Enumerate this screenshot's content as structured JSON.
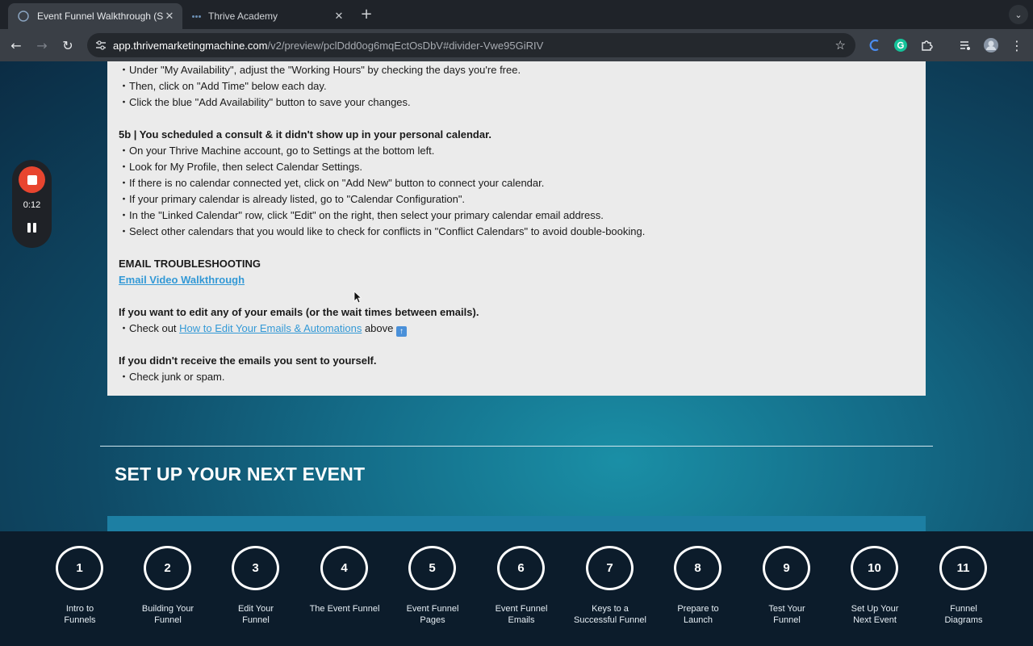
{
  "browser": {
    "tabs": [
      {
        "title": "Event Funnel Walkthrough (S",
        "active": true
      },
      {
        "title": "Thrive Academy",
        "active": false
      }
    ],
    "url_host": "app.thrivemarketingmachine.com",
    "url_path": "/v2/preview/pclDdd0og6mqEctOsDbV#divider-Vwe95GiRIV"
  },
  "recorder": {
    "time": "0:12"
  },
  "content": {
    "lines": [
      {
        "text": "・Under \"My Availability\", adjust the \"Working Hours\" by checking the days you're free."
      },
      {
        "text": "・Then, click on \"Add Time\" below each day."
      },
      {
        "text": "・Click the blue \"Add Availability\" button to save your changes."
      },
      {
        "text": "5b | You scheduled a consult & it didn't show up in your personal calendar."
      },
      {
        "text": "・On your Thrive Machine account, go to Settings at the bottom left."
      },
      {
        "text": "・Look for My Profile, then select Calendar Settings."
      },
      {
        "text": "・If there is no calendar connected yet, click on \"Add New\" button to connect your calendar."
      },
      {
        "text": "・If your primary calendar is already listed, go to \"Calendar Configuration\"."
      },
      {
        "text": "・In the \"Linked Calendar\" row, click \"Edit\" on the right, then select your primary calendar email address."
      },
      {
        "text": "・Select other calendars that you would like to check for conflicts in \"Conflict Calendars\" to avoid double-booking."
      },
      {
        "text": "EMAIL TROUBLESHOOTING"
      },
      {
        "text": "Email Video Walkthrough"
      },
      {
        "text": "If you want to edit any of your emails (or the wait times between emails)."
      },
      {
        "prefix": "・Check out ",
        "link": "How to Edit Your Emails & Automations",
        "suffix": " above "
      },
      {
        "text": "If you didn't receive the emails you sent to yourself."
      },
      {
        "text": "・Check junk or spam."
      }
    ]
  },
  "section_title": "SET UP YOUR NEXT EVENT",
  "steps": [
    {
      "num": "1",
      "label": "Intro to\nFunnels"
    },
    {
      "num": "2",
      "label": "Building Your\nFunnel"
    },
    {
      "num": "3",
      "label": "Edit Your\nFunnel"
    },
    {
      "num": "4",
      "label": "The Event Funnel"
    },
    {
      "num": "5",
      "label": "Event Funnel\nPages"
    },
    {
      "num": "6",
      "label": "Event Funnel\nEmails"
    },
    {
      "num": "7",
      "label": "Keys to a\nSuccessful Funnel"
    },
    {
      "num": "8",
      "label": "Prepare to\nLaunch"
    },
    {
      "num": "9",
      "label": "Test Your\nFunnel"
    },
    {
      "num": "10",
      "label": "Set Up Your\nNext Event"
    },
    {
      "num": "11",
      "label": "Funnel\nDiagrams"
    }
  ]
}
